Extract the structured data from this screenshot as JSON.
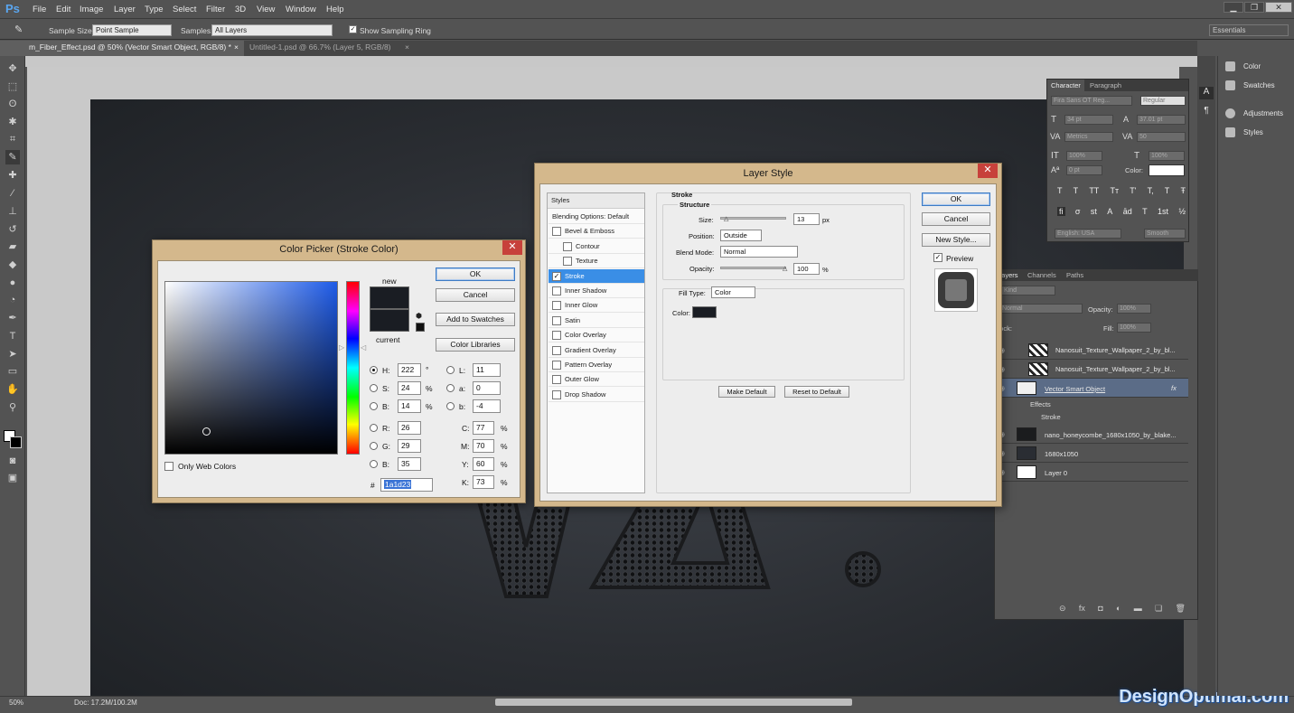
{
  "app": {
    "logo": "Ps",
    "menu": [
      "File",
      "Edit",
      "Image",
      "Layer",
      "Type",
      "Select",
      "Filter",
      "3D",
      "View",
      "Window",
      "Help"
    ],
    "window_buttons": [
      "▁",
      "❐",
      "✕"
    ]
  },
  "options": {
    "sample_size_label": "Sample Size:",
    "sample_size_value": "Point Sample",
    "samples_label": "Samples:",
    "samples_value": "All Layers",
    "show_ring_label": "Show Sampling Ring",
    "workspace": "Essentials"
  },
  "tabs": [
    {
      "label": "m_Fiber_Effect.psd @ 50% (Vector Smart Object, RGB/8) *",
      "close": "×"
    },
    {
      "label": "Untitled-1.psd @ 66.7% (Layer 5, RGB/8)",
      "close": "×"
    }
  ],
  "status": {
    "zoom": "50%",
    "doc": "Doc: 17.2M/100.2M"
  },
  "watermark": "DesignOptimal.com",
  "right_panels": [
    {
      "label": "Color"
    },
    {
      "label": "Swatches"
    },
    {
      "label": "Adjustments"
    },
    {
      "label": "Styles"
    }
  ],
  "character": {
    "tabs": [
      "Character",
      "Paragraph"
    ],
    "font": "Fira Sans OT Reg...",
    "style": "Regular",
    "size": "34 pt",
    "leading": "37.01 pt",
    "kerning": "Metrics",
    "tracking": "50",
    "vscale": "100%",
    "hscale": "100%",
    "baseline": "0 pt",
    "color_label": "Color:",
    "type_buttons": [
      "T",
      "T",
      "TT",
      "Tт",
      "T'",
      "T,",
      "T",
      "Ŧ"
    ],
    "ot_buttons": [
      "fi",
      "σ",
      "st",
      "A",
      "ād",
      "T",
      "1st",
      "½"
    ],
    "language": "English: USA",
    "aa": "Smooth"
  },
  "layers": {
    "tabs": [
      "Layers",
      "Channels",
      "Paths"
    ],
    "kind": "Kind",
    "blend": "Normal",
    "opacity_label": "Opacity:",
    "opacity": "100%",
    "lock_label": "Lock:",
    "fill_label": "Fill:",
    "fill": "100%",
    "rows": [
      {
        "name": "Nanosuit_Texture_Wallpaper_2_by_bl..."
      },
      {
        "name": "Nanosuit_Texture_Wallpaper_2_by_bl..."
      },
      {
        "name": "Vector Smart Object",
        "fx": "fx"
      },
      {
        "name": "Effects"
      },
      {
        "name": "Stroke"
      },
      {
        "name": "nano_honeycombe_1680x1050_by_blake..."
      },
      {
        "name": "1680x1050"
      },
      {
        "name": "Layer 0"
      }
    ]
  },
  "color_picker": {
    "title": "Color Picker (Stroke Color)",
    "close": "✕",
    "new_label": "new",
    "current_label": "current",
    "ok": "OK",
    "cancel": "Cancel",
    "add_swatches": "Add to Swatches",
    "color_libraries": "Color Libraries",
    "only_web": "Only Web Colors",
    "fields": {
      "H": "222",
      "S": "24",
      "B": "14",
      "R": "26",
      "G": "29",
      "Bb": "35",
      "L": "11",
      "a": "0",
      "b": "-4",
      "C": "77",
      "M": "70",
      "Y": "60",
      "K": "73",
      "hex": "1a1d23"
    },
    "units": {
      "deg": "°",
      "pct": "%"
    },
    "swatch_color": "#1a1d23",
    "hue_color": "#1e5be8"
  },
  "layer_style": {
    "title": "Layer Style",
    "close": "✕",
    "styles_header": "Styles",
    "items": [
      {
        "label": "Blending Options: Default",
        "check": false
      },
      {
        "label": "Bevel & Emboss",
        "check": true
      },
      {
        "label": "Contour",
        "check": true,
        "indent": true
      },
      {
        "label": "Texture",
        "check": true,
        "indent": true
      },
      {
        "label": "Stroke",
        "check": true,
        "checked": true,
        "selected": true
      },
      {
        "label": "Inner Shadow",
        "check": true
      },
      {
        "label": "Inner Glow",
        "check": true
      },
      {
        "label": "Satin",
        "check": true
      },
      {
        "label": "Color Overlay",
        "check": true
      },
      {
        "label": "Gradient Overlay",
        "check": true
      },
      {
        "label": "Pattern Overlay",
        "check": true
      },
      {
        "label": "Outer Glow",
        "check": true
      },
      {
        "label": "Drop Shadow",
        "check": true
      }
    ],
    "stroke_title": "Stroke",
    "structure_title": "Structure",
    "size_label": "Size:",
    "size": "13",
    "size_unit": "px",
    "position_label": "Position:",
    "position": "Outside",
    "blend_label": "Blend Mode:",
    "blend": "Normal",
    "opacity_label": "Opacity:",
    "opacity": "100",
    "opacity_unit": "%",
    "fill_type_label": "Fill Type:",
    "fill_type": "Color",
    "color_label": "Color:",
    "make_default": "Make Default",
    "reset_default": "Reset to Default",
    "ok": "OK",
    "cancel": "Cancel",
    "new_style": "New Style...",
    "preview": "Preview"
  }
}
